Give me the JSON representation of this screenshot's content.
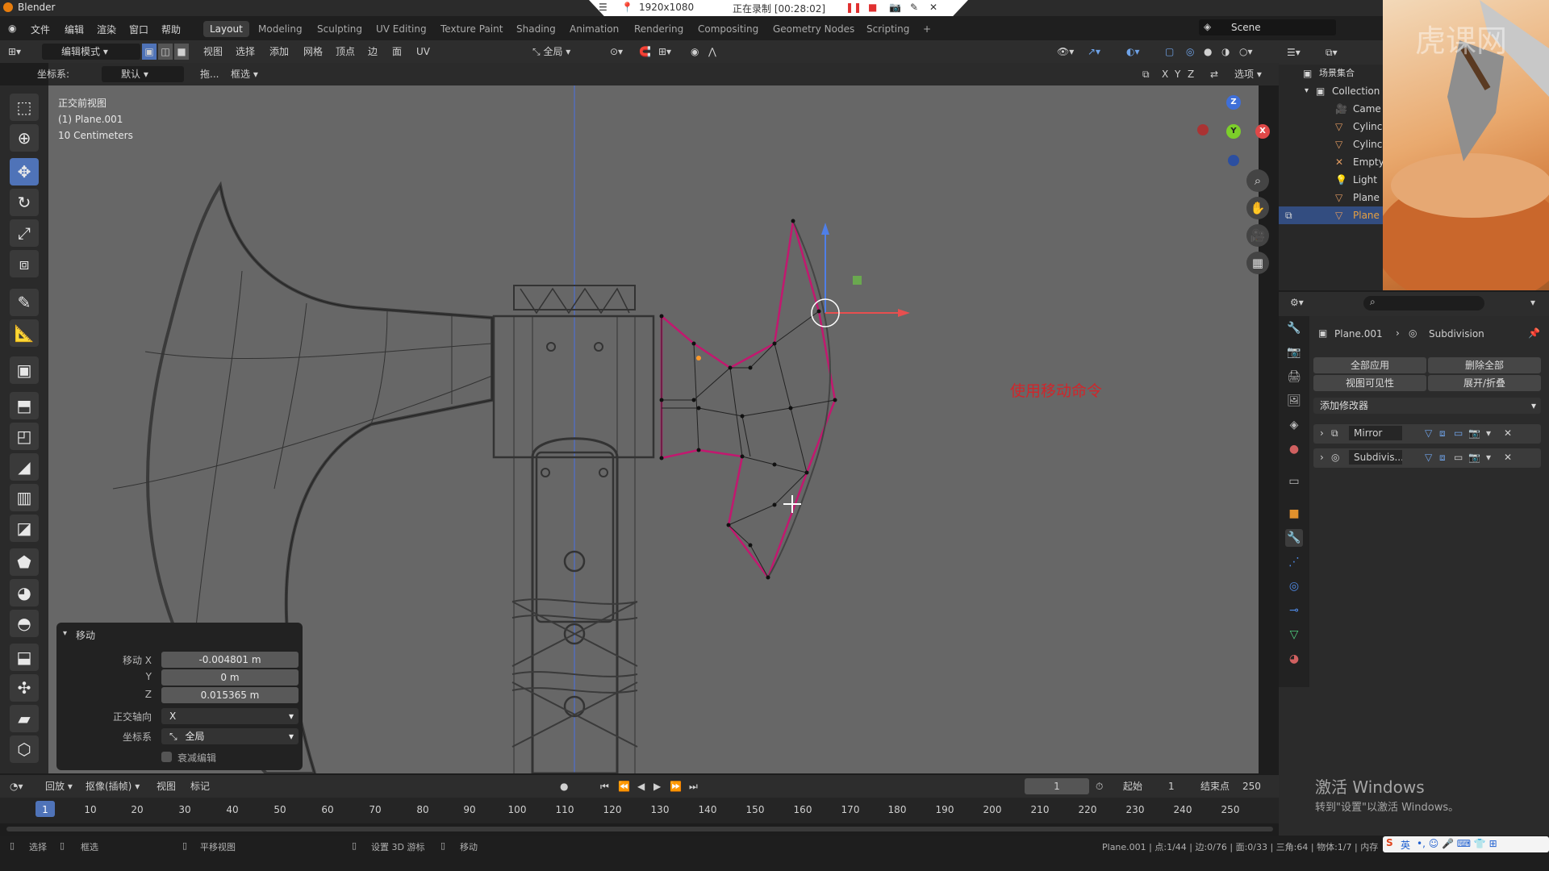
{
  "titlebar": {
    "app_name": "Blender",
    "resolution": "1920x1080",
    "recording": "正在录制 [00:28:02]"
  },
  "menubar": {
    "items": [
      "文件",
      "编辑",
      "渲染",
      "窗口",
      "帮助"
    ],
    "workspaces": [
      "Layout",
      "Modeling",
      "Sculpting",
      "UV Editing",
      "Texture Paint",
      "Shading",
      "Animation",
      "Rendering",
      "Compositing",
      "Geometry Nodes",
      "Scripting"
    ],
    "add_tab": "+",
    "scene": "Scene"
  },
  "header": {
    "mode": "编辑模式",
    "menus": [
      "视图",
      "选择",
      "添加",
      "网格",
      "顶点",
      "边",
      "面",
      "UV"
    ],
    "transform_space": "全局",
    "coord_label": "坐标系:",
    "coord_value": "默认",
    "drag_label": "拖...",
    "select_mode": "框选",
    "axes": [
      "X",
      "Y",
      "Z"
    ],
    "options": "选项"
  },
  "viewport": {
    "view_name": "正交前视图",
    "object": "(1) Plane.001",
    "scale": "10 Centimeters",
    "annotation": "使用移动命令",
    "annotation_color": "#d0262b"
  },
  "operator_panel": {
    "title": "移动",
    "move_x_label": "移动 X",
    "move_x": "-0.004801 m",
    "y_label": "Y",
    "y": "0 m",
    "z_label": "Z",
    "z": "0.015365 m",
    "ortho_label": "正交轴向",
    "ortho_value": "X",
    "coord_label": "坐标系",
    "coord_value": "全局",
    "proportional": "衰减编辑"
  },
  "outliner": {
    "header": "场景集合",
    "collection": "Collection",
    "items": [
      "Came",
      "Cylinc",
      "Cylinc",
      "Empty",
      "Light",
      "Plane",
      "Plane"
    ]
  },
  "properties": {
    "object": "Plane.001",
    "modifier_context": "Subdivision",
    "apply_all": "全部应用",
    "delete_all": "删除全部",
    "viewport_vis": "视图可见性",
    "expand_collapse": "展开/折叠",
    "add_modifier": "添加修改器",
    "modifiers": [
      "Mirror",
      "Subdivis..."
    ]
  },
  "timeline": {
    "menus": [
      "回放",
      "抠像(插帧)",
      "视图",
      "标记"
    ],
    "current_frame": "1",
    "start_label": "起始",
    "start": "1",
    "end_label": "结束点",
    "end": "250",
    "ticks": [
      "1",
      "10",
      "20",
      "30",
      "40",
      "50",
      "60",
      "70",
      "80",
      "90",
      "100",
      "110",
      "120",
      "130",
      "140",
      "150",
      "160",
      "170",
      "180",
      "190",
      "200",
      "210",
      "220",
      "230",
      "240",
      "250"
    ]
  },
  "statusbar": {
    "select": "选择",
    "box_select": "框选",
    "pan": "平移视图",
    "set_cursor": "设置 3D 游标",
    "move": "移动",
    "stats": "Plane.001 | 点:1/44 | 边:0/76 | 面:0/33 | 三角:64 | 物体:1/7 | 内存",
    "ime": "英"
  },
  "windows": {
    "activate": "激活 Windows",
    "activate_hint": "转到\"设置\"以激活 Windows。"
  },
  "watermark": "虎课网"
}
